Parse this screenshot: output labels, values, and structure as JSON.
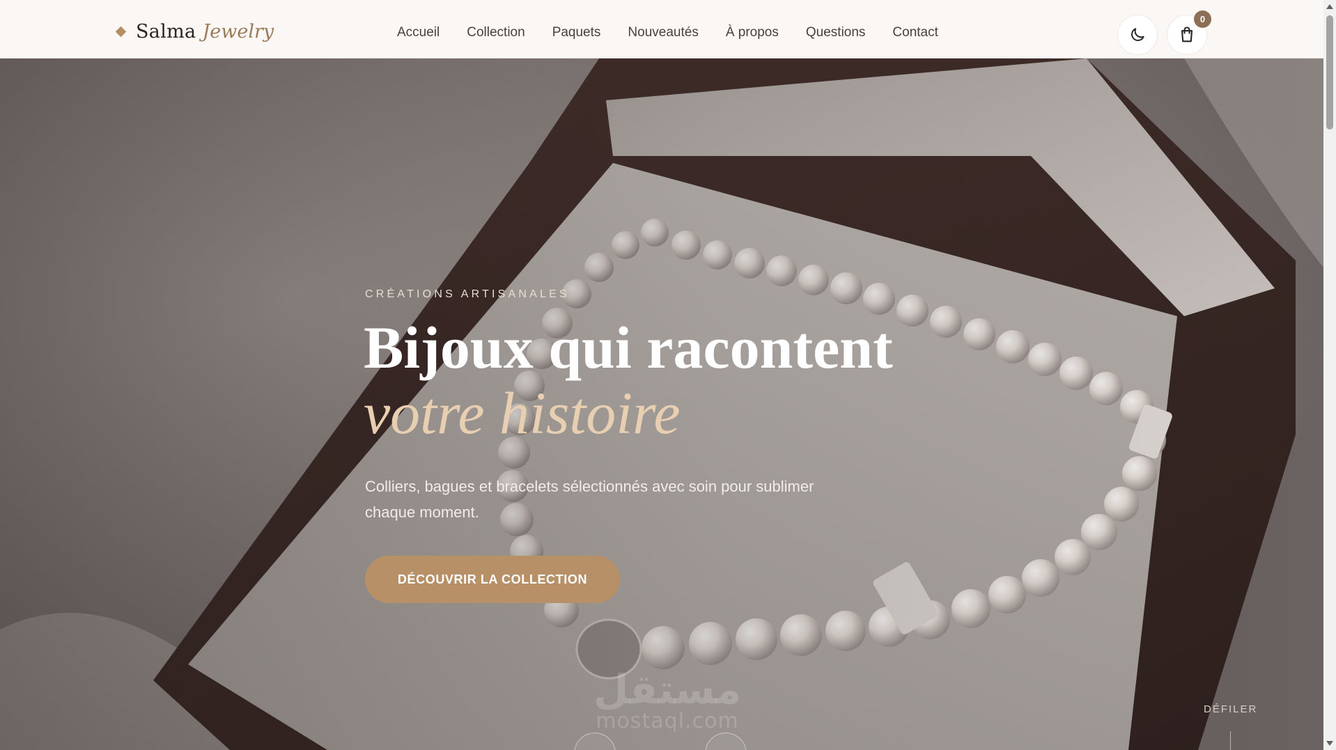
{
  "header": {
    "brand": {
      "name": "Salma",
      "accent": "Jewelry",
      "logo_icon": "diamond-icon"
    },
    "nav": [
      {
        "label": "Accueil"
      },
      {
        "label": "Collection"
      },
      {
        "label": "Paquets"
      },
      {
        "label": "Nouveautés"
      },
      {
        "label": "À propos"
      },
      {
        "label": "Questions"
      },
      {
        "label": "Contact"
      }
    ],
    "theme_toggle_icon": "moon-icon",
    "cart": {
      "icon": "shopping-bag-icon",
      "count": "0"
    }
  },
  "hero": {
    "eyebrow": "CRÉATIONS ARTISANALES",
    "title_line1": "Bijoux qui racontent",
    "title_line2": "votre histoire",
    "description": "Colliers, bagues et bracelets sélectionnés avec soin pour sublimer chaque moment.",
    "cta_label": "DÉCOUVRIR LA COLLECTION",
    "scroll_label": "DÉFILER",
    "background": "pearl-necklace-in-box-image"
  },
  "watermark": {
    "arabic": "مستقل",
    "latin": "mostaql.com"
  },
  "colors": {
    "accent": "#b89068",
    "accent_text": "#e8cfb1",
    "brand_accent": "#9c7b5b",
    "header_bg": "#faf7f4",
    "badge": "#8c6f55"
  }
}
